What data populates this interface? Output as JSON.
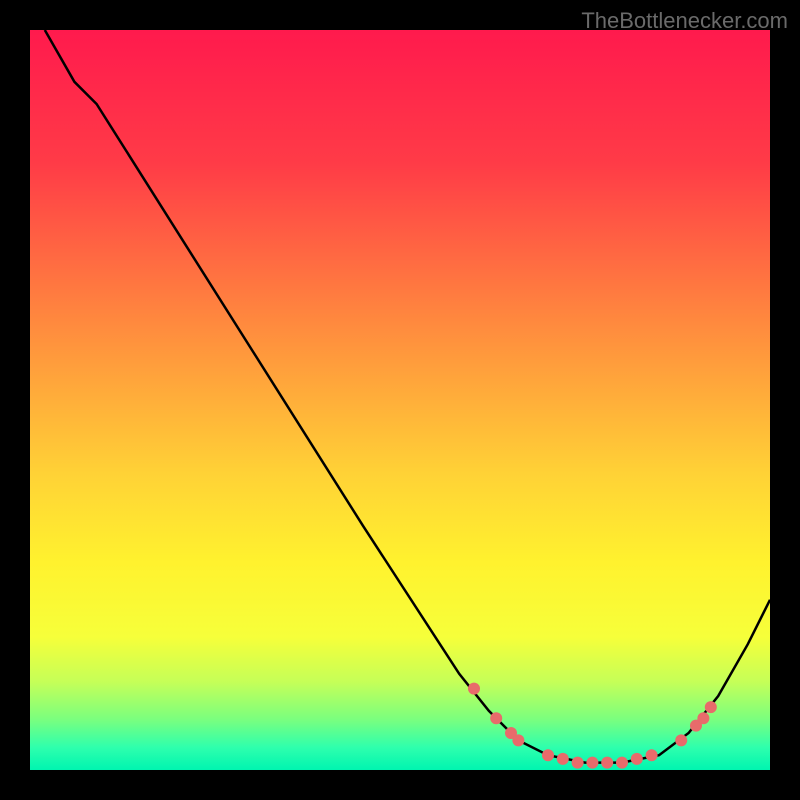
{
  "watermark": "TheBottlenecker.com",
  "chart_data": {
    "type": "line",
    "title": "",
    "xlabel": "",
    "ylabel": "",
    "xlim": [
      0,
      100
    ],
    "ylim": [
      0,
      100
    ],
    "gradient_stops": [
      {
        "offset": 0,
        "color": "#ff1a4d"
      },
      {
        "offset": 0.18,
        "color": "#ff3b47"
      },
      {
        "offset": 0.4,
        "color": "#ff8b3e"
      },
      {
        "offset": 0.6,
        "color": "#ffd236"
      },
      {
        "offset": 0.72,
        "color": "#fff22e"
      },
      {
        "offset": 0.82,
        "color": "#f6ff3a"
      },
      {
        "offset": 0.88,
        "color": "#c6ff57"
      },
      {
        "offset": 0.93,
        "color": "#7dff7d"
      },
      {
        "offset": 0.97,
        "color": "#2dffad"
      },
      {
        "offset": 1.0,
        "color": "#00f5b0"
      }
    ],
    "curve": [
      {
        "x": 2,
        "y": 100
      },
      {
        "x": 6,
        "y": 93
      },
      {
        "x": 9,
        "y": 90
      },
      {
        "x": 45,
        "y": 33
      },
      {
        "x": 58,
        "y": 13
      },
      {
        "x": 62,
        "y": 8
      },
      {
        "x": 66,
        "y": 4
      },
      {
        "x": 70,
        "y": 2
      },
      {
        "x": 75,
        "y": 1
      },
      {
        "x": 80,
        "y": 1
      },
      {
        "x": 85,
        "y": 2
      },
      {
        "x": 89,
        "y": 5
      },
      {
        "x": 93,
        "y": 10
      },
      {
        "x": 97,
        "y": 17
      },
      {
        "x": 100,
        "y": 23
      }
    ],
    "dots": [
      {
        "x": 60,
        "y": 11
      },
      {
        "x": 63,
        "y": 7
      },
      {
        "x": 65,
        "y": 5
      },
      {
        "x": 66,
        "y": 4
      },
      {
        "x": 70,
        "y": 2
      },
      {
        "x": 72,
        "y": 1.5
      },
      {
        "x": 74,
        "y": 1
      },
      {
        "x": 76,
        "y": 1
      },
      {
        "x": 78,
        "y": 1
      },
      {
        "x": 80,
        "y": 1
      },
      {
        "x": 82,
        "y": 1.5
      },
      {
        "x": 84,
        "y": 2
      },
      {
        "x": 88,
        "y": 4
      },
      {
        "x": 90,
        "y": 6
      },
      {
        "x": 91,
        "y": 7
      },
      {
        "x": 92,
        "y": 8.5
      }
    ],
    "dot_color": "#e86b6b",
    "dot_radius": 6
  }
}
